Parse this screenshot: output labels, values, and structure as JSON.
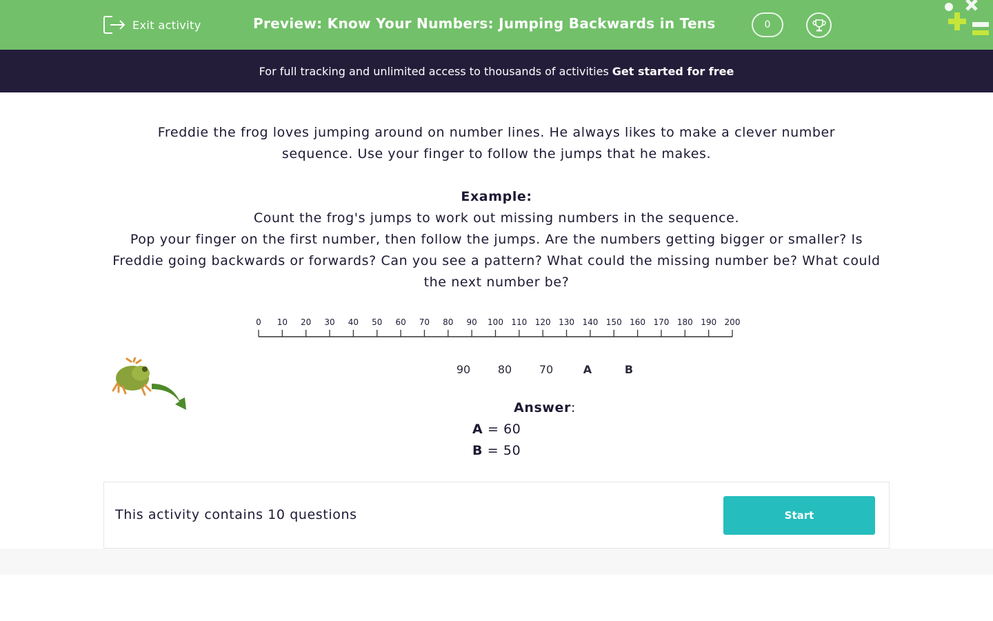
{
  "header": {
    "exit_label": "Exit activity",
    "title": "Preview: Know Your Numbers: Jumping Backwards in Tens",
    "score": "0",
    "bg_color": "#72c06a"
  },
  "promo": {
    "text": "For full tracking and unlimited access to thousands of activities",
    "cta": "Get started for free",
    "bg_color": "#241d3a"
  },
  "question": {
    "intro": "Freddie the frog loves jumping around on number lines. He always likes to make a clever number sequence. Use your finger to follow the jumps that he makes.",
    "example_heading": "Example:",
    "example_line1": "Count the frog's jumps to work out missing numbers in the sequence.",
    "example_line2": "Pop your finger on the first number, then follow the jumps. Are the numbers getting bigger or smaller? Is Freddie going backwards or forwards? Can you see a pattern? What could the missing number be? What could the next number be?"
  },
  "number_line": {
    "labels": [
      "0",
      "10",
      "20",
      "30",
      "40",
      "50",
      "60",
      "70",
      "80",
      "90",
      "100",
      "110",
      "120",
      "130",
      "140",
      "150",
      "160",
      "170",
      "180",
      "190",
      "200"
    ]
  },
  "sequence": [
    "90",
    "80",
    "70",
    "A",
    "B"
  ],
  "answer": {
    "heading": "Answer",
    "colon": ":",
    "a_label": "A",
    "a_value": "= 60",
    "b_label": "B",
    "b_value": "= 50"
  },
  "card": {
    "text": "This activity contains 10 questions",
    "start_label": "Start",
    "start_color": "#25bdbd"
  },
  "icons": [
    "exit-icon",
    "trophy-icon",
    "logo-icon",
    "frog-icon",
    "arrow-icon"
  ]
}
